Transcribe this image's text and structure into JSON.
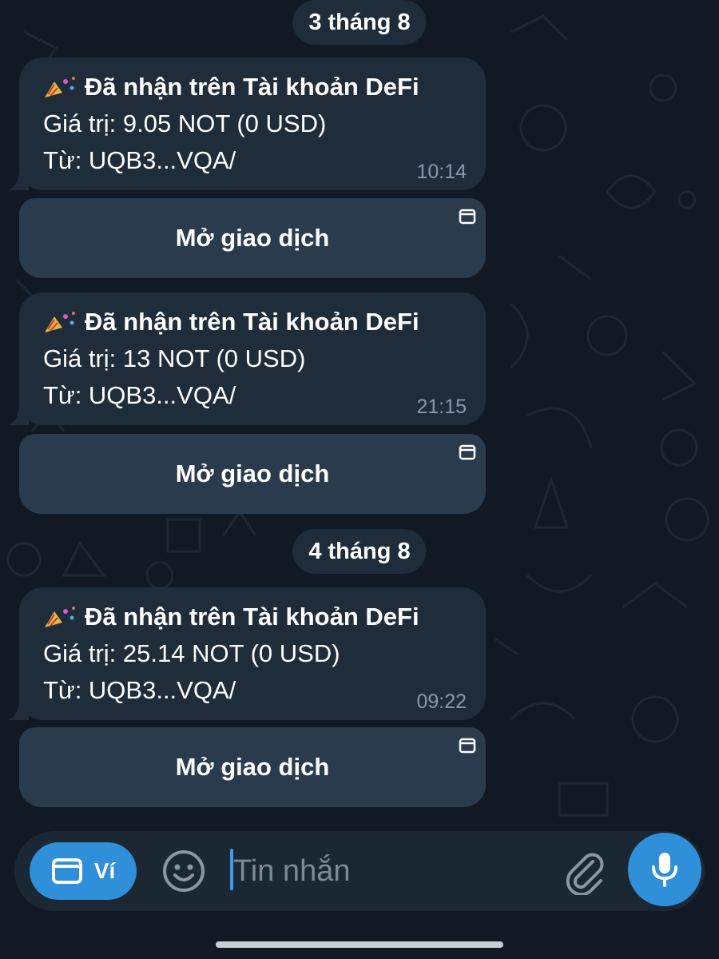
{
  "chat": {
    "day_groups": [
      {
        "date_label": "3 tháng 8",
        "messages": [
          {
            "title": "Đã nhận trên Tài khoản DeFi",
            "value_line": "Giá trị: 9.05 NOT (0 USD)",
            "from_line": "Từ: UQB3...VQA/",
            "time": "10:14",
            "button_label": "Mở giao dịch"
          },
          {
            "title": "Đã nhận trên Tài khoản DeFi",
            "value_line": "Giá trị: 13 NOT (0 USD)",
            "from_line": "Từ: UQB3...VQA/",
            "time": "21:15",
            "button_label": "Mở giao dịch"
          }
        ]
      },
      {
        "date_label": "4 tháng 8",
        "messages": [
          {
            "title": "Đã nhận trên Tài khoản DeFi",
            "value_line": "Giá trị: 25.14 NOT (0 USD)",
            "from_line": "Từ: UQB3...VQA/",
            "time": "09:22",
            "button_label": "Mở giao dịch"
          }
        ]
      }
    ]
  },
  "composer": {
    "wallet_label": "Ví",
    "placeholder": "Tin nhắn"
  },
  "icons": {
    "message_emoji": "party-popper-icon",
    "button_corner": "app-window-icon",
    "wallet": "wallet-window-icon",
    "emoji": "smiley-icon",
    "attach": "paperclip-icon",
    "mic": "microphone-icon"
  },
  "colors": {
    "background": "#111a24",
    "bubble": "#1f2c3a",
    "inline_button": "#2a3b4e",
    "accent": "#2f8fd9",
    "timestamp": "#8a98a7"
  }
}
